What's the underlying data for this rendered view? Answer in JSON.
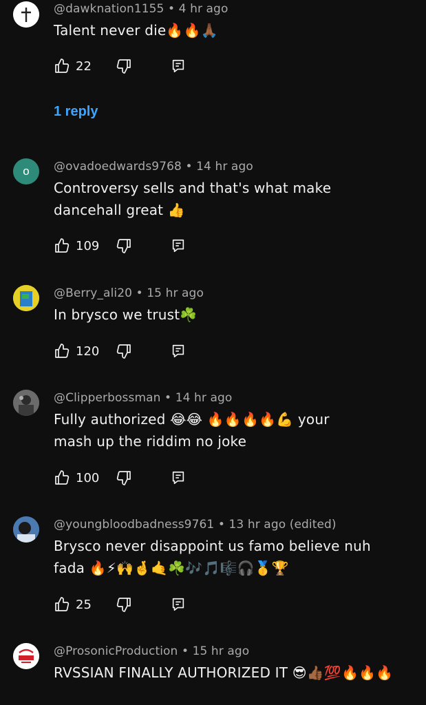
{
  "comments": [
    {
      "author": "@dawknation1155",
      "age": "4 hr ago",
      "text": "Talent never die🔥🔥🙏🏾",
      "likes": "22",
      "replies_label": "1 reply",
      "avatar_color": "#ffffff"
    },
    {
      "author": "@ovadoedwards9768",
      "age": "14 hr ago",
      "text": "Controversy sells and that's what make dancehall great 👍",
      "likes": "109",
      "avatar_letter": "O",
      "avatar_color": "#2e8b7a"
    },
    {
      "author": "@Berry_ali20",
      "age": "15 hr ago",
      "text": "In brysco we trust☘️",
      "likes": "120",
      "avatar_color": "#e6d028"
    },
    {
      "author": "@Clipperbossman",
      "age": "14 hr ago",
      "text": "Fully authorized 😂😂 🔥🔥🔥🔥💪 your mash up the riddim no joke",
      "likes": "100",
      "avatar_color": "#5a5a5a"
    },
    {
      "author": "@youngbloodbadness9761",
      "age": "13 hr ago (edited)",
      "text": "Brysco never disappoint us famo believe nuh fada 🔥⚡🙌🤞🤙☘️🎶🎵🎼🎧🥇🏆",
      "likes": "25",
      "avatar_color": "#3a5f8a"
    },
    {
      "author": "@ProsonicProduction",
      "age": "15 hr ago",
      "text": "RVSSIAN FINALLY AUTHORIZED IT 😎👍🏾💯🔥🔥🔥",
      "avatar_color": "#ffffff"
    }
  ],
  "separator": "•",
  "icons": {
    "like": "thumbs-up-icon",
    "dislike": "thumbs-down-icon",
    "reply": "reply-comment-icon"
  },
  "colors": {
    "background": "#0f0f0f",
    "text": "#f1f1f1",
    "meta": "#aaaaaa",
    "link": "#3ea6ff"
  }
}
